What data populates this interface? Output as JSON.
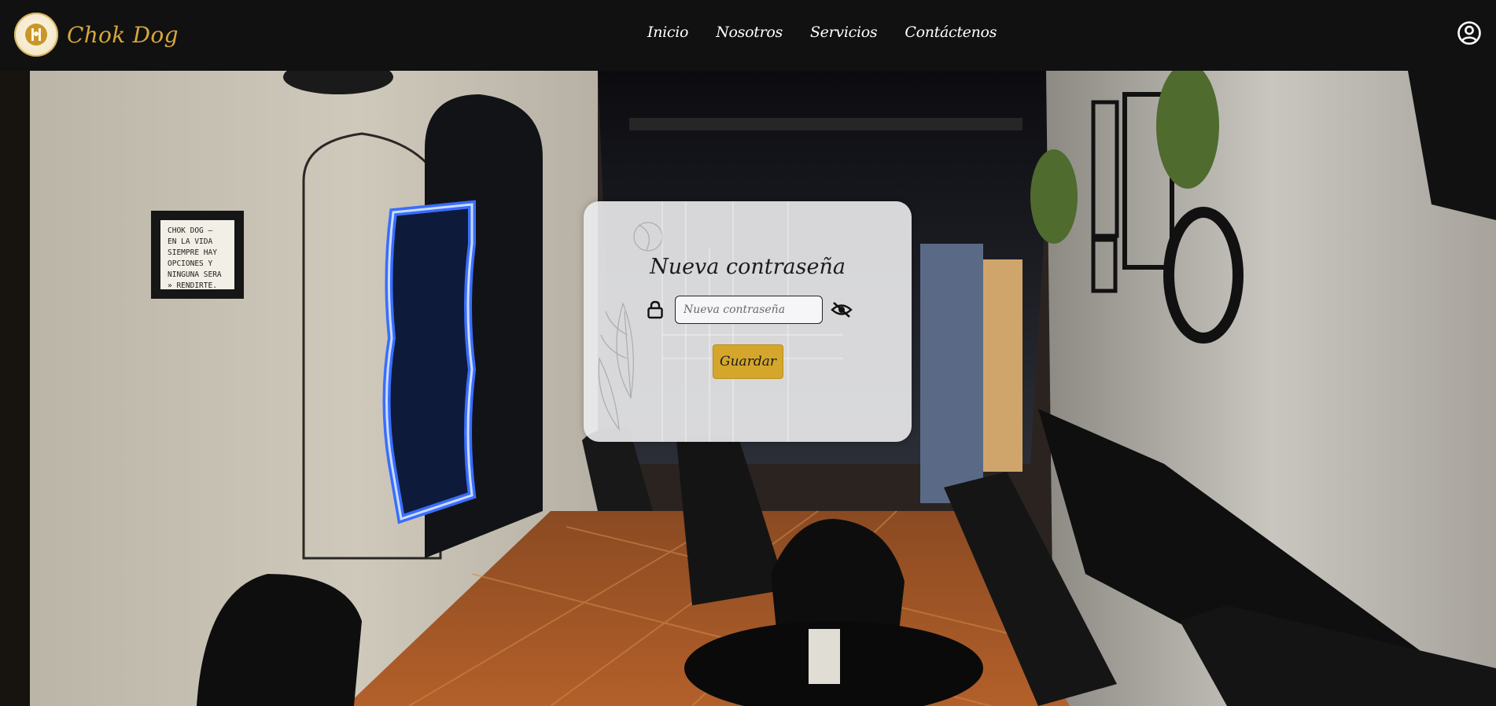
{
  "navbar": {
    "brand": "Chok Dog",
    "links": [
      "Inicio",
      "Nosotros",
      "Servicios",
      "Contáctenos"
    ],
    "user_icon": "user-circle-icon"
  },
  "background": {
    "sign_lines": [
      "CHOK DOG —",
      "EN LA VIDA",
      "SIEMPRE HAY",
      "OPCIONES Y",
      "NINGUNA SERA",
      "» RENDIRTE."
    ]
  },
  "card": {
    "title": "Nueva contraseña",
    "input_placeholder": "Nueva contraseña",
    "input_value": "",
    "save_label": "Guardar",
    "lock_icon": "lock-icon",
    "eye_icon": "eye-off-icon"
  },
  "colors": {
    "navbar_bg": "#111111",
    "brand": "#d6a73c",
    "button": "#d4a72c",
    "card_bg": "#ececee"
  }
}
